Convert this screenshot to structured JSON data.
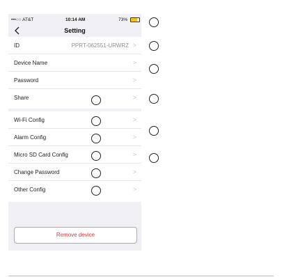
{
  "status_bar": {
    "carrier": "•••○○ AT&T",
    "time": "10:14 AM",
    "battery": "73%",
    "battery_level": 0.73
  },
  "nav": {
    "title": "Setting",
    "back_icon": "chevron-left-icon"
  },
  "groups": [
    {
      "rows": [
        {
          "label": "ID",
          "value": "PPRT-062551-URWRZ"
        },
        {
          "label": "Device Name",
          "value": ""
        },
        {
          "label": "Password",
          "value": ""
        },
        {
          "label": "Share",
          "value": ""
        }
      ]
    },
    {
      "rows": [
        {
          "label": "Wi-Fi Config",
          "value": ""
        },
        {
          "label": "Alarm Config",
          "value": ""
        },
        {
          "label": "Micro SD Card Config",
          "value": ""
        },
        {
          "label": "Change Password",
          "value": ""
        },
        {
          "label": "Other Config",
          "value": ""
        }
      ]
    }
  ],
  "chevron": ">",
  "remove_button": "Remove device",
  "colors": {
    "accent_red": "#e5353a",
    "background": "#efeff4"
  }
}
